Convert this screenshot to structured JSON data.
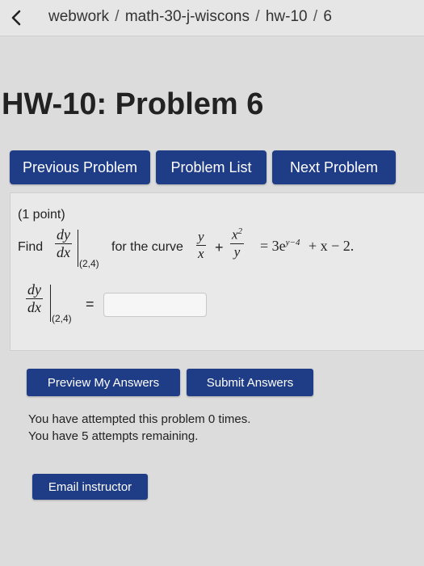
{
  "breadcrumb": {
    "back_icon": "chevron-left-icon",
    "parts": [
      "webwork",
      "math-30-j-wiscons",
      "hw-10",
      "6"
    ],
    "separator": "/"
  },
  "page_title": "HW-10: Problem 6",
  "nav": {
    "previous_label": "Previous Problem",
    "list_label": "Problem List",
    "next_label": "Next Problem"
  },
  "problem": {
    "points": "(1 point)",
    "find": "Find",
    "for_curve": "for the curve",
    "deriv_num": "dy",
    "deriv_den": "dx",
    "eval_point": "(2,4)",
    "frac1_num": "y",
    "frac1_den": "x",
    "plus": "+",
    "frac2_num": "x",
    "frac2_num_exp": "2",
    "frac2_den": "y",
    "rhs": "= 3e",
    "rhs_exp": "y−4",
    "rhs_tail": "+ x − 2.",
    "answer_equals": "=",
    "answer_value": ""
  },
  "actions": {
    "preview_label": "Preview My Answers",
    "submit_label": "Submit Answers"
  },
  "status": {
    "attempted": "You have attempted this problem 0 times.",
    "remaining": "You have 5 attempts remaining."
  },
  "email_label": "Email instructor",
  "colors": {
    "button_bg": "#1f3c87",
    "page_bg": "#dcdcdc"
  }
}
